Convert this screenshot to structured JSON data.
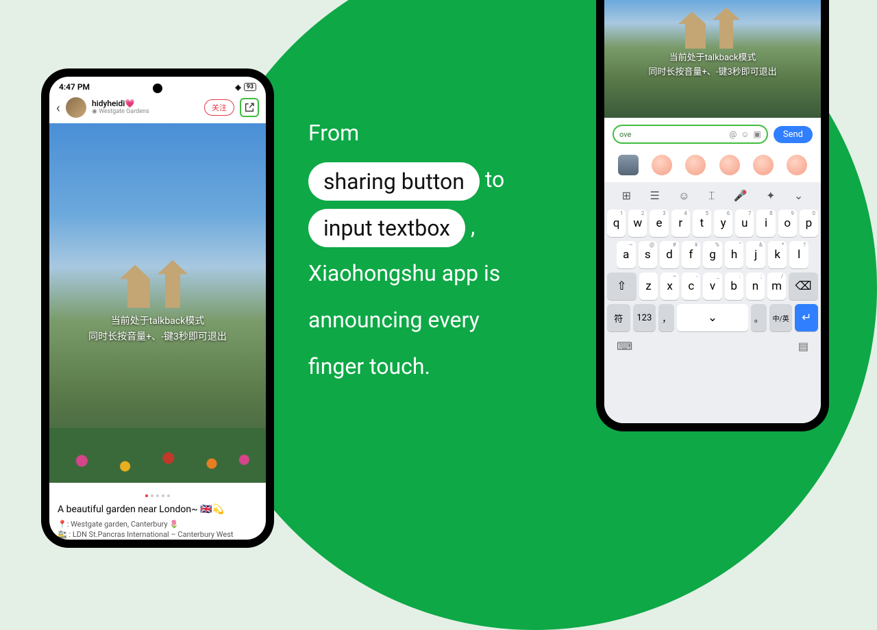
{
  "headline": {
    "line1": "From",
    "pill1": "sharing button",
    "mid": "to",
    "pill2": "input textbox",
    "comma": ",",
    "rest1": "Xiaohongshu app is",
    "rest2": "announcing every",
    "rest3": "finger touch."
  },
  "left": {
    "time": "4:47 PM",
    "battery": "93",
    "username": "hidyheidi💗",
    "location_prefix": "◉ ",
    "location": "Westgate Gardens",
    "follow": "关注",
    "talkback_l1": "当前处于talkback模式",
    "talkback_l2": "同时长按音量+、-键3秒即可退出",
    "caption": "A beautiful garden near London~ 🇬🇧💫",
    "meta1": "📍: Westgate garden, Canterbury 🌷",
    "meta2": "🚉 : LDN St.Pancras International – Canterbury West"
  },
  "right": {
    "talkback_l1": "当前处于talkback模式",
    "talkback_l2": "同时长按音量+、-键3秒即可退出",
    "input_value": "ove",
    "send": "Send",
    "keyboard": {
      "row1": [
        {
          "k": "q",
          "h": "1"
        },
        {
          "k": "w",
          "h": "2"
        },
        {
          "k": "e",
          "h": "3"
        },
        {
          "k": "r",
          "h": "4"
        },
        {
          "k": "t",
          "h": "5"
        },
        {
          "k": "y",
          "h": "6"
        },
        {
          "k": "u",
          "h": "7"
        },
        {
          "k": "i",
          "h": "8"
        },
        {
          "k": "o",
          "h": "9"
        },
        {
          "k": "p",
          "h": "0"
        }
      ],
      "row2": [
        {
          "k": "a",
          "h": "~"
        },
        {
          "k": "s",
          "h": "@"
        },
        {
          "k": "d",
          "h": "#"
        },
        {
          "k": "f",
          "h": "¥"
        },
        {
          "k": "g",
          "h": "%"
        },
        {
          "k": "h",
          "h": "\""
        },
        {
          "k": "j",
          "h": "&"
        },
        {
          "k": "k",
          "h": "*"
        },
        {
          "k": "l",
          "h": "?"
        }
      ],
      "row3": [
        {
          "k": "z",
          "h": ""
        },
        {
          "k": "x",
          "h": "~"
        },
        {
          "k": "c",
          "h": "-"
        },
        {
          "k": "v",
          "h": "_"
        },
        {
          "k": "b",
          "h": ":"
        },
        {
          "k": "n",
          "h": ";"
        },
        {
          "k": "m",
          "h": "/"
        }
      ],
      "fn_sym": "符",
      "fn_123": "123",
      "fn_comma": "，",
      "fn_period": "。",
      "fn_lang": "中/英"
    }
  }
}
